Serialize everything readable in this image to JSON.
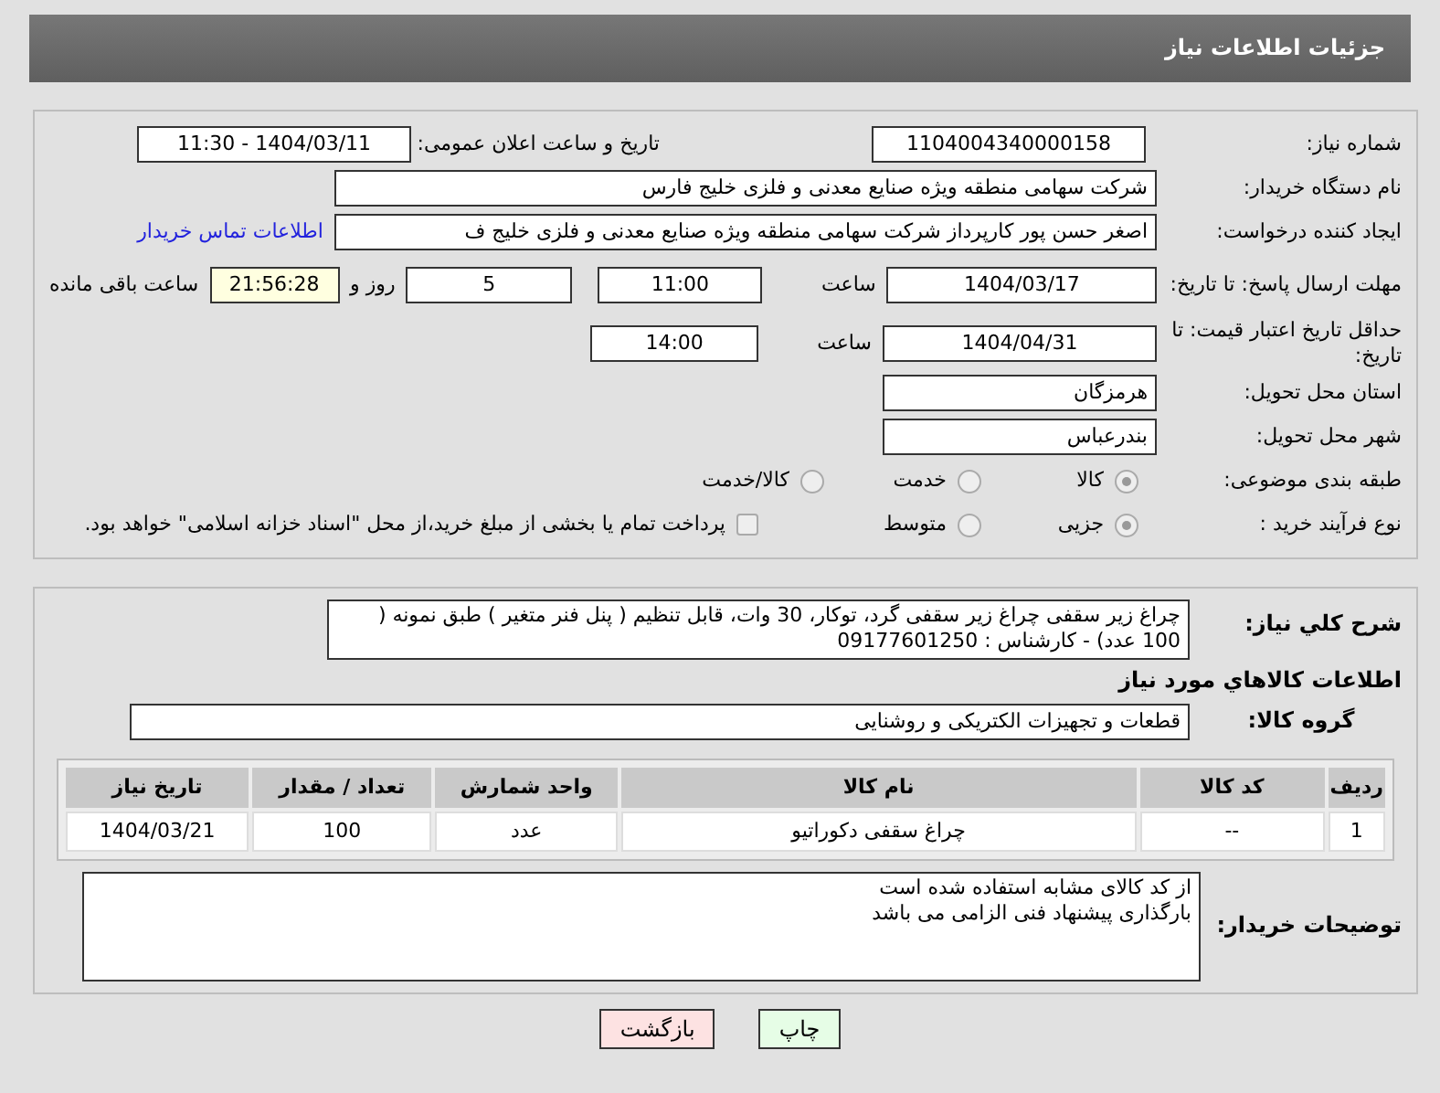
{
  "title": "جزئیات اطلاعات نیاز",
  "need_number": {
    "label": "شماره نیاز:",
    "value": "1104004340000158"
  },
  "announce": {
    "label": "تاریخ و ساعت اعلان عمومی:",
    "value": "1404/03/11 - 11:30"
  },
  "buyer": {
    "label": "نام دستگاه خریدار:",
    "value": "شرکت سهامی منطقه ویژه صنایع معدنی و فلزی خلیج فارس"
  },
  "requester": {
    "label": "ایجاد کننده درخواست:",
    "value": "اصغر حسن پور کارپرداز شرکت سهامی منطقه ویژه صنایع معدنی و فلزی خلیج ف",
    "link": "اطلاعات تماس خریدار"
  },
  "deadline": {
    "label": "مهلت ارسال پاسخ: تا تاریخ:",
    "date": "1404/03/17",
    "time_label": "ساعت",
    "time": "11:00",
    "days": "5",
    "days_label": "روز و",
    "remaining": "21:56:28",
    "remaining_label": "ساعت باقی مانده"
  },
  "validity": {
    "label": "حداقل تاریخ اعتبار قیمت: تا تاریخ:",
    "date": "1404/04/31",
    "time_label": "ساعت",
    "time": "14:00"
  },
  "province": {
    "label": "استان محل تحویل:",
    "value": "هرمزگان"
  },
  "city": {
    "label": "شهر محل تحویل:",
    "value": "بندرعباس"
  },
  "category": {
    "label": "طبقه بندی موضوعی:",
    "options": [
      {
        "label": "کالا",
        "selected": true
      },
      {
        "label": "خدمت",
        "selected": false
      },
      {
        "label": "کالا/خدمت",
        "selected": false
      }
    ]
  },
  "process": {
    "label": "نوع فرآیند خرید :",
    "options": [
      {
        "label": "جزیی",
        "selected": true
      },
      {
        "label": "متوسط",
        "selected": false
      }
    ],
    "payment": {
      "label": "پرداخت تمام یا بخشی از مبلغ خرید،از محل \"اسناد خزانه اسلامی\" خواهد بود.",
      "checked": false
    }
  },
  "description": {
    "label": "شرح کلي نياز:",
    "value": "چراغ زیر سقفی چراغ زیر سقفی گرد، توکار، 30 وات، قابل تنظیم ( پنل فنر متغیر ) طبق نمونه ( 100 عدد) - کارشناس : 09177601250"
  },
  "goods_heading": "اطلاعات كالاهاي مورد نياز",
  "group": {
    "label": "گروه کالا:",
    "value": "قطعات و تجهیزات الکتریکی و روشنایی"
  },
  "table": {
    "columns": [
      "ردیف",
      "کد کالا",
      "نام کالا",
      "واحد شمارش",
      "تعداد / مقدار",
      "تاریخ نیاز"
    ],
    "rows": [
      [
        "1",
        "--",
        "چراغ سقفی دکوراتیو",
        "عدد",
        "100",
        "1404/03/21"
      ]
    ]
  },
  "buyer_notes": {
    "label": "توضیحات خریدار:",
    "lines": [
      "از کد کالای مشابه استفاده شده است",
      "بارگذاری پیشنهاد فنی الزامی می باشد"
    ]
  },
  "buttons": [
    {
      "kind": "print",
      "label": "چاپ"
    },
    {
      "kind": "back",
      "label": "بازگشت"
    }
  ]
}
